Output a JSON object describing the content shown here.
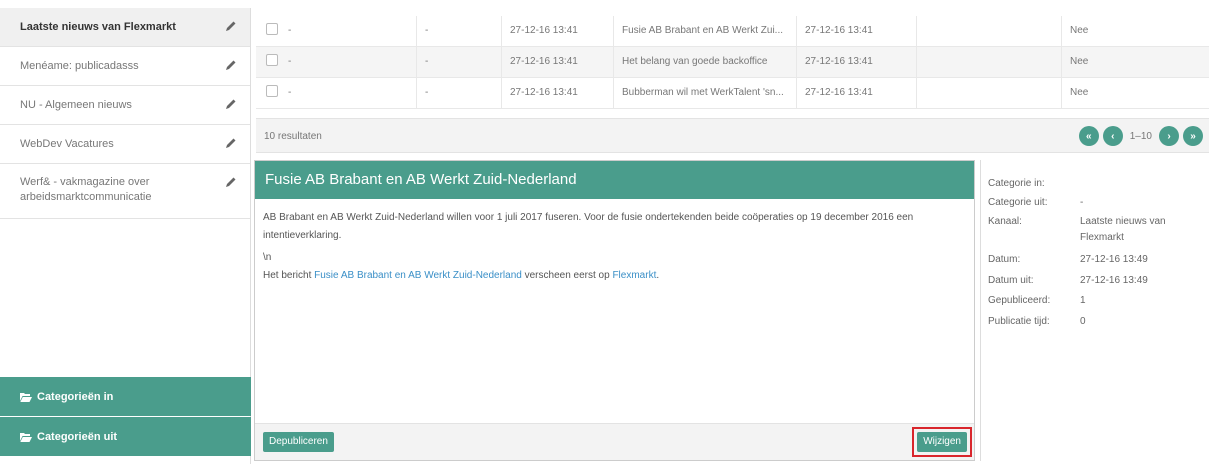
{
  "sidebar": {
    "feeds": [
      {
        "label": "Laatste nieuws van Flexmarkt"
      },
      {
        "label": "Menéame: publicadasss"
      },
      {
        "label": "NU - Algemeen nieuws"
      },
      {
        "label": "WebDev Vacatures"
      },
      {
        "label": "Werf& - vakmagazine over arbeidsmarktcommunicatie"
      }
    ],
    "categories_in": "Categorieën in",
    "categories_out": "Categorieën uit"
  },
  "table": {
    "rows": [
      {
        "c1": "-",
        "c2": "-",
        "c3": "27-12-16 13:41",
        "c4": "Fusie AB Brabant en AB Werkt Zui...",
        "c5": "27-12-16 13:41",
        "c6": "",
        "c7": "Nee"
      },
      {
        "c1": "-",
        "c2": "-",
        "c3": "27-12-16 13:41",
        "c4": "Het belang van goede backoffice",
        "c5": "27-12-16 13:41",
        "c6": "",
        "c7": "Nee"
      },
      {
        "c1": "-",
        "c2": "-",
        "c3": "27-12-16 13:41",
        "c4": "Bubberman wil met WerkTalent 'sn...",
        "c5": "27-12-16 13:41",
        "c6": "",
        "c7": "Nee"
      }
    ],
    "results": "10 resultaten",
    "range": "1–10"
  },
  "detail": {
    "title": "Fusie AB Brabant en AB Werkt Zuid-Nederland",
    "para1": "AB Brabant en AB Werkt Zuid-Nederland willen voor 1 juli 2017 fuseren. Voor de fusie ondertekenden beide coöperaties op 19 december 2016 een intentieverklaring.",
    "escape": "\\n",
    "prefix": "Het bericht ",
    "link1": "Fusie AB Brabant en AB Werkt Zuid-Nederland",
    "middle": " verscheen eerst op ",
    "link2": "Flexmarkt",
    "suffix": ".",
    "depublish": "Depubliceren",
    "edit": "Wijzigen"
  },
  "info": {
    "cat_in_label": "Categorie in:",
    "cat_in_value": "",
    "cat_out_label": "Categorie uit:",
    "cat_out_value": "-",
    "channel_label": "Kanaal:",
    "channel_value": "Laatste nieuws van Flexmarkt",
    "date_label": "Datum:",
    "date_value": "27-12-16 13:49",
    "date_out_label": "Datum uit:",
    "date_out_value": "27-12-16 13:49",
    "published_label": "Gepubliceerd:",
    "published_value": "1",
    "pubtime_label": "Publicatie tijd:",
    "pubtime_value": "0"
  },
  "colors": {
    "accent": "#4a9d8c",
    "highlight": "#d9262c",
    "link": "#3a8fc7"
  }
}
